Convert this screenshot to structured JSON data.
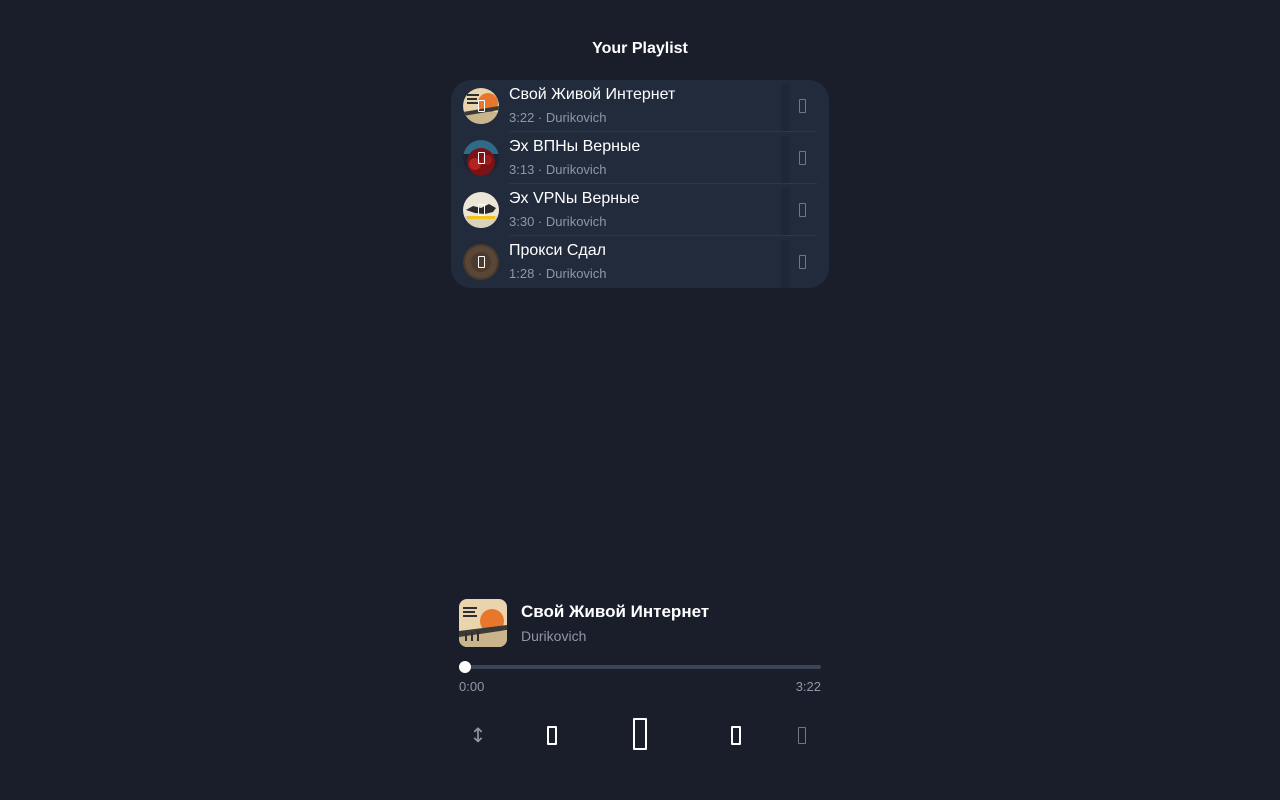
{
  "header": {
    "title": "Your Playlist"
  },
  "playlist": {
    "tracks": [
      {
        "title": "Свой Живой Интернет",
        "meta": "3:22 · Durikovich",
        "art": "sunset-icon",
        "action_icon": "more-icon"
      },
      {
        "title": "Эх ВПНы Верные",
        "meta": "3:13 · Durikovich",
        "art": "red-night-icon",
        "action_icon": "more-icon"
      },
      {
        "title": "Эх VPNы Верные",
        "meta": "3:30 · Durikovich",
        "art": "stamp-icon",
        "action_icon": "more-icon"
      },
      {
        "title": "Прокси Сдал",
        "meta": "1:28 · Durikovich",
        "art": "brown-disc-icon",
        "action_icon": "more-icon"
      }
    ]
  },
  "now_playing": {
    "title": "Свой Живой Интернет",
    "artist": "Durikovich",
    "current_time": "0:00",
    "total_time": "3:22",
    "progress": 0
  },
  "controls": {
    "shuffle_icon": "↕",
    "icons": [
      "shuffle-icon",
      "previous-icon",
      "play-icon",
      "next-icon",
      "repeat-icon"
    ]
  },
  "colors": {
    "background": "#1a1e2b",
    "card": "#222b3b",
    "muted_text": "#8e97a8",
    "progress_track": "#3c4556"
  }
}
